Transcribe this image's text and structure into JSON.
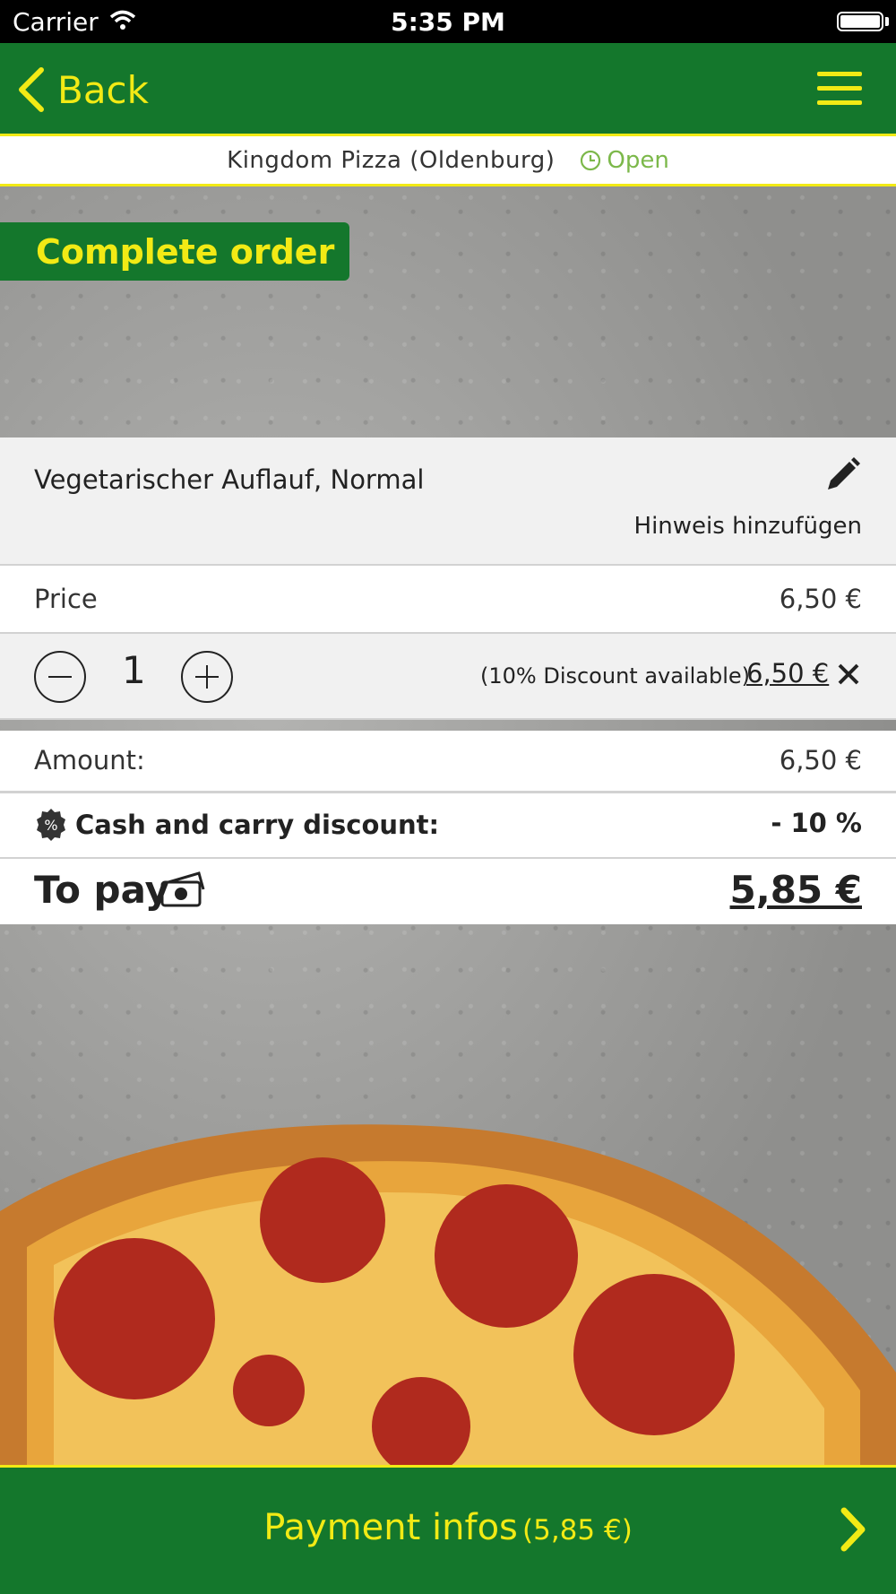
{
  "status_bar": {
    "carrier": "Carrier",
    "time": "5:35 PM"
  },
  "nav": {
    "back_label": "Back"
  },
  "restaurant": {
    "name": "Kingdom Pizza (Oldenburg)",
    "status": "Open"
  },
  "page": {
    "badge": "Complete order"
  },
  "item": {
    "name": "Vegetarischer Auflauf, Normal",
    "add_note": "Hinweis hinzufügen",
    "price_label": "Price",
    "price": "6,50 €",
    "quantity": "1",
    "discount_note": "(10% Discount available)",
    "line_total": "6,50 €"
  },
  "summary": {
    "amount_label": "Amount:",
    "amount": "6,50 €",
    "discount_label": "Cash and carry discount:",
    "discount": "- 10 %",
    "topay_label": "To pay",
    "topay": "5,85 €"
  },
  "footer": {
    "payment_label": "Payment infos",
    "payment_amount": "(5,85 €)"
  },
  "colors": {
    "brand_green": "#14772c",
    "accent_yellow": "#f2ea15",
    "open_green": "#7cb84a"
  },
  "icons": [
    "wifi-icon",
    "battery-icon",
    "back-chevron-icon",
    "hamburger-menu-icon",
    "clock-icon",
    "pencil-icon",
    "minus-icon",
    "plus-icon",
    "close-icon",
    "percent-badge-icon",
    "money-icon",
    "chevron-right-icon"
  ]
}
